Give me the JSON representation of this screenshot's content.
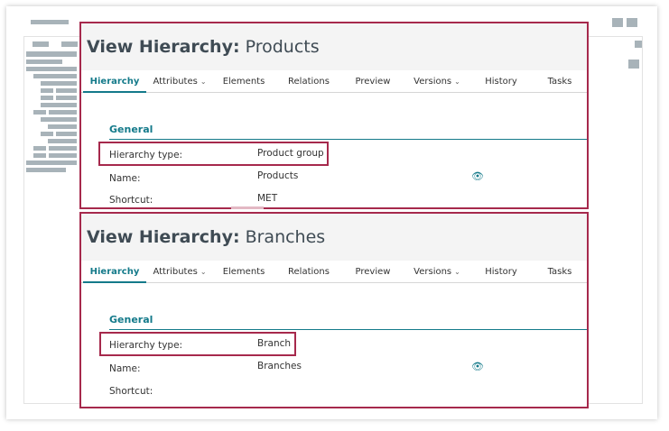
{
  "panels": [
    {
      "title_prefix": "View Hierarchy:",
      "title_name": "Products",
      "tabs": [
        {
          "label": "Hierarchy",
          "active": true
        },
        {
          "label": "Attributes",
          "dropdown": true
        },
        {
          "label": "Elements"
        },
        {
          "label": "Relations"
        },
        {
          "label": "Preview"
        },
        {
          "label": "Versions",
          "dropdown": true
        },
        {
          "label": "History"
        },
        {
          "label": "Tasks"
        }
      ],
      "section": "General",
      "fields": {
        "hierarchy_type_label": "Hierarchy type:",
        "hierarchy_type_value": "Product group",
        "name_label": "Name:",
        "name_value": "Products",
        "shortcut_label": "Shortcut:",
        "shortcut_value": "MET"
      }
    },
    {
      "title_prefix": "View Hierarchy:",
      "title_name": "Branches",
      "tabs": [
        {
          "label": "Hierarchy",
          "active": true
        },
        {
          "label": "Attributes",
          "dropdown": true
        },
        {
          "label": "Elements"
        },
        {
          "label": "Relations"
        },
        {
          "label": "Preview"
        },
        {
          "label": "Versions",
          "dropdown": true
        },
        {
          "label": "History"
        },
        {
          "label": "Tasks"
        }
      ],
      "section": "General",
      "fields": {
        "hierarchy_type_label": "Hierarchy type:",
        "hierarchy_type_value": "Branch",
        "name_label": "Name:",
        "name_value": "Branches",
        "shortcut_label": "Shortcut:",
        "shortcut_value": ""
      }
    }
  ],
  "icons": {
    "dropdown": "chevron-down-icon",
    "visibility": "eye-icon"
  },
  "colors": {
    "accent": "#147a8a",
    "highlight": "#a6294c",
    "placeholder": "#a8b3b9"
  }
}
